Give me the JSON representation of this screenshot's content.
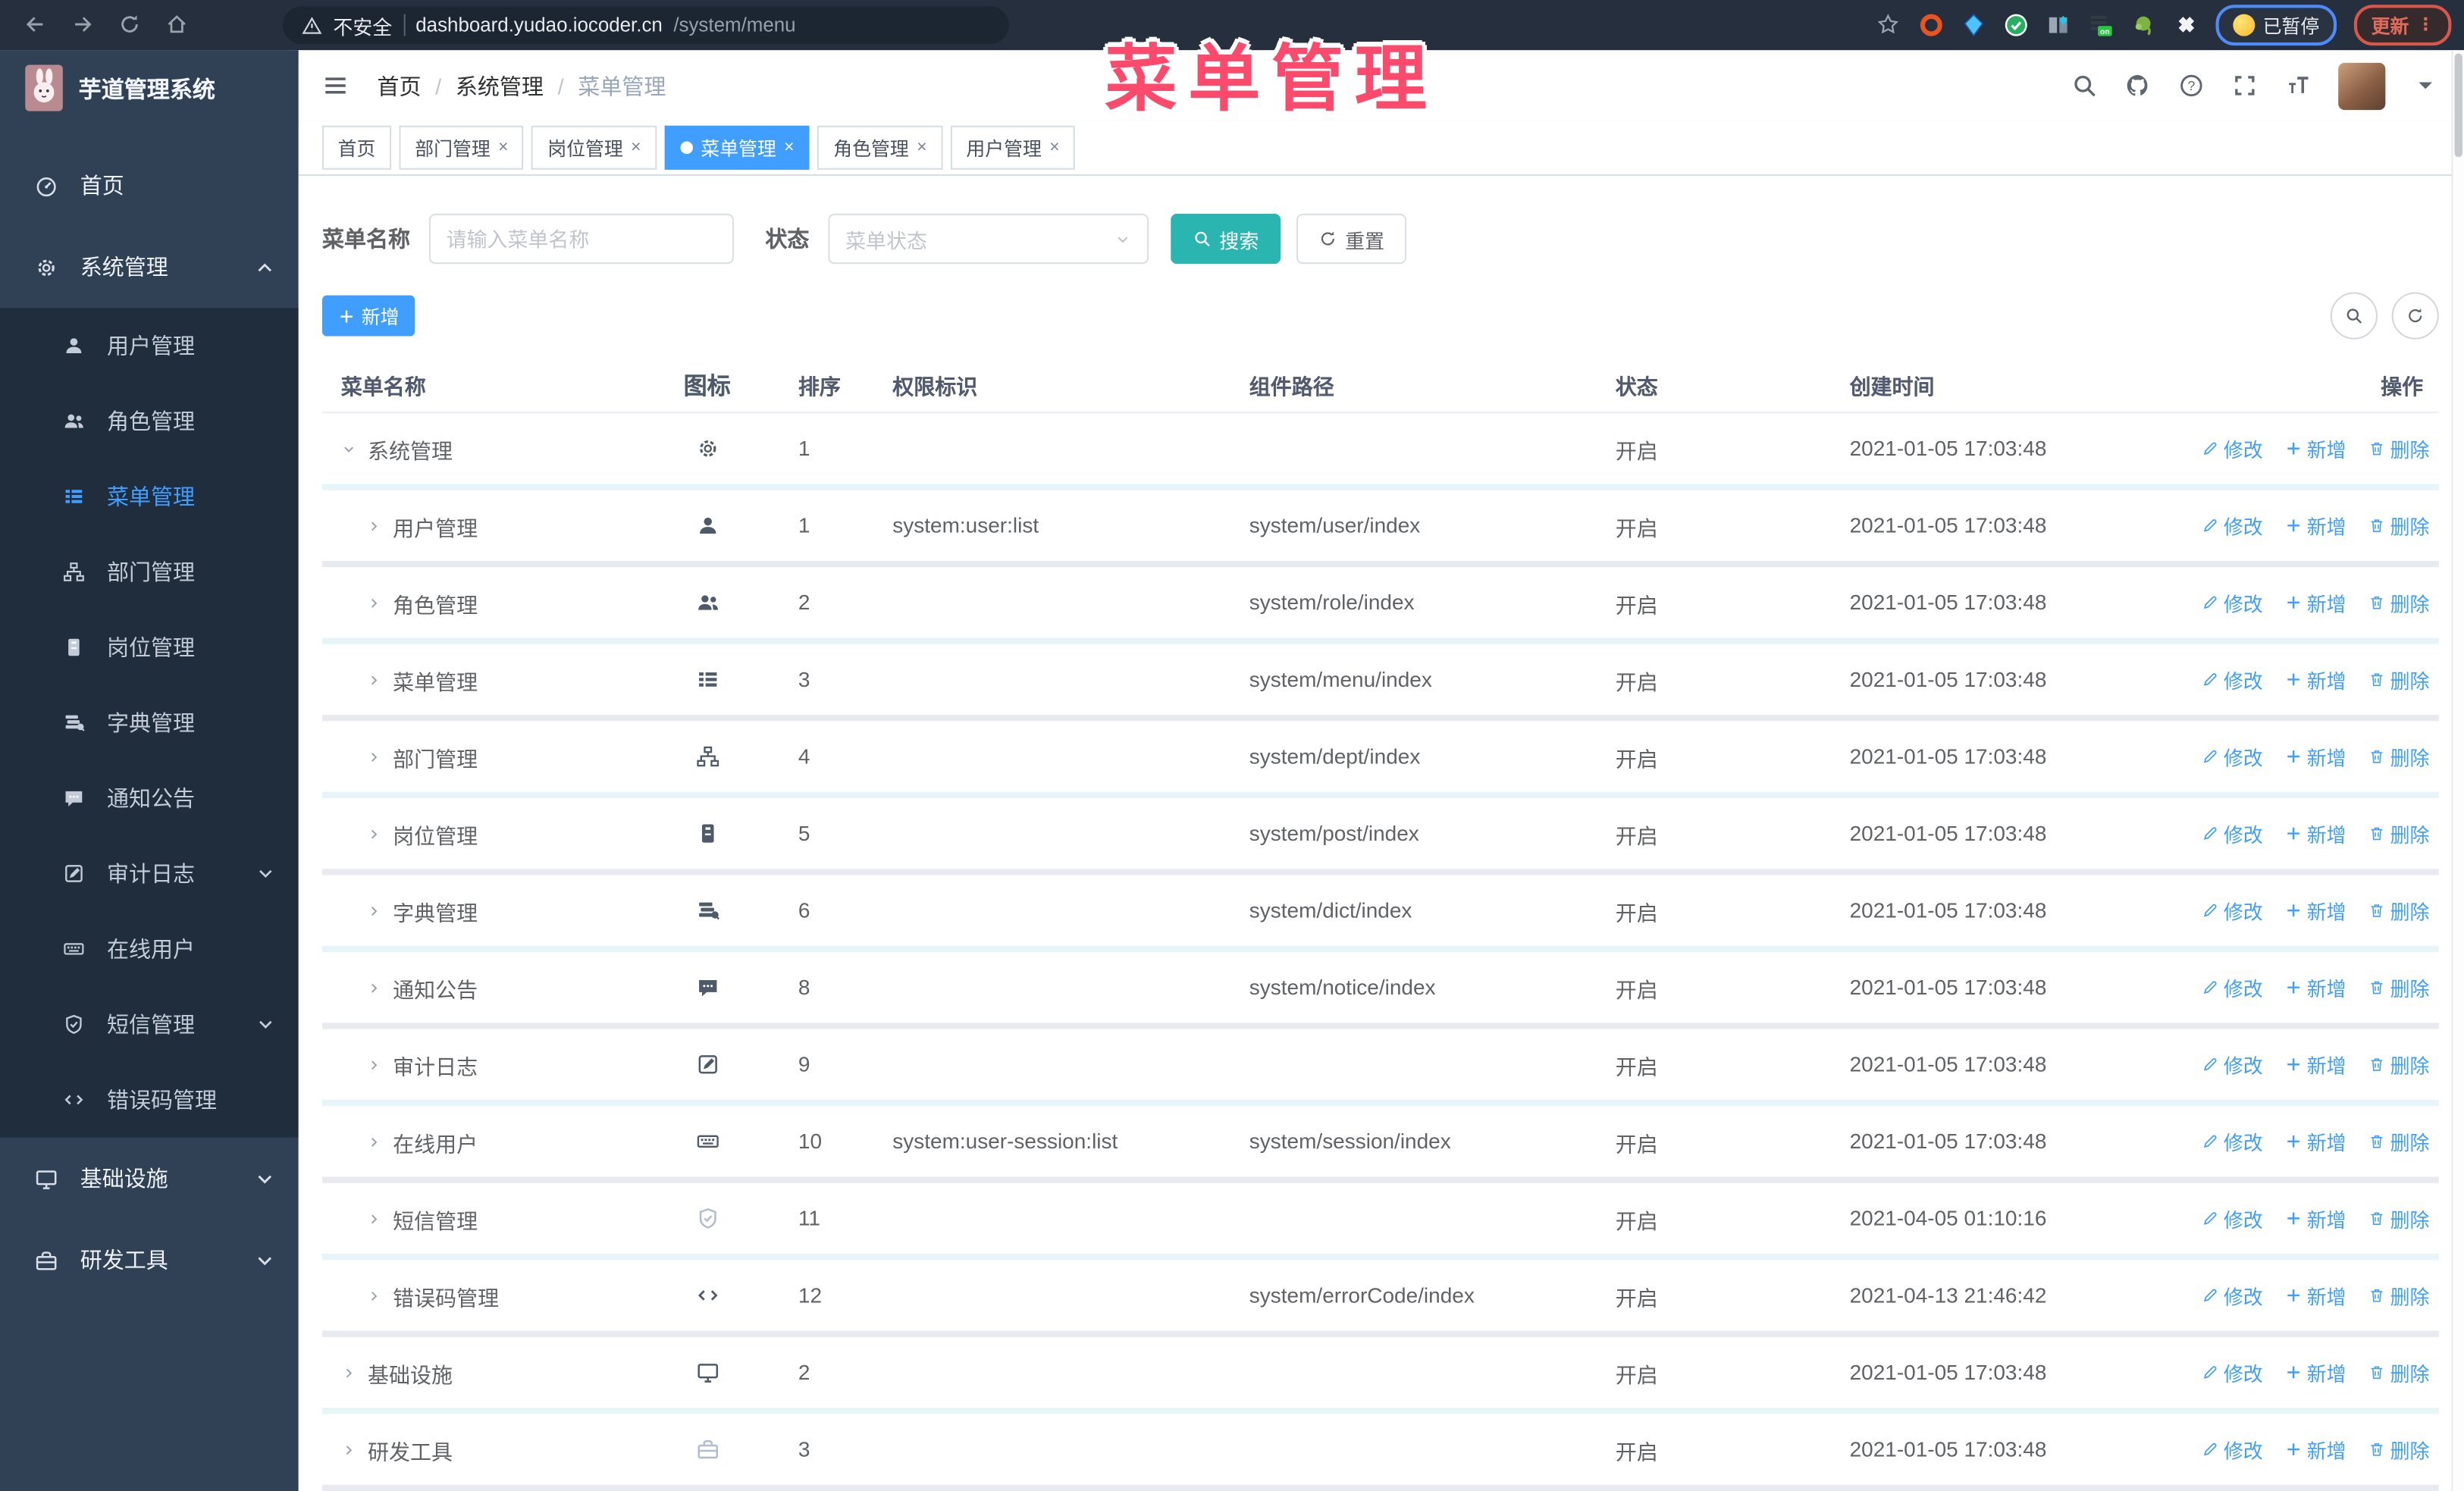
{
  "colors": {
    "accent": "#409eff",
    "search_teal": "#2bb5b0",
    "watermark_pink": "#fb4a6b",
    "sidebar_bg": "#304156",
    "submenu_bg": "#1f2d3d"
  },
  "browser": {
    "security_label": "不安全",
    "url_host": "dashboard.yudao.iocoder.cn",
    "url_path": "/system/menu",
    "extensions": [
      "orange-ring-extension",
      "blue-gem-extension",
      "green-check-extension",
      "blue-tiles-extension",
      "list-on-extension",
      "green-monkey-extension",
      "puzzle-extension"
    ],
    "paused_label": "已暂停",
    "update_label": "更新"
  },
  "watermark": "菜单管理",
  "app": {
    "title": "芋道管理系统"
  },
  "breadcrumb": [
    "首页",
    "系统管理",
    "菜单管理"
  ],
  "sidebar": {
    "items": [
      {
        "key": "home",
        "label": "首页",
        "icon": "gauge",
        "level": 0
      },
      {
        "key": "system-management",
        "label": "系统管理",
        "icon": "gear",
        "level": 0,
        "chevron": "up"
      },
      {
        "key": "user-management",
        "label": "用户管理",
        "icon": "user",
        "level": 1
      },
      {
        "key": "role-management",
        "label": "角色管理",
        "icon": "users",
        "level": 1
      },
      {
        "key": "menu-management",
        "label": "菜单管理",
        "icon": "menu",
        "level": 1,
        "active": true
      },
      {
        "key": "dept-management",
        "label": "部门管理",
        "icon": "tree",
        "level": 1
      },
      {
        "key": "post-management",
        "label": "岗位管理",
        "icon": "badge",
        "level": 1
      },
      {
        "key": "dict-management",
        "label": "字典管理",
        "icon": "book",
        "level": 1
      },
      {
        "key": "notice",
        "label": "通知公告",
        "icon": "chat",
        "level": 1
      },
      {
        "key": "audit-log",
        "label": "审计日志",
        "icon": "note",
        "level": 1,
        "chevron": "down"
      },
      {
        "key": "online-users",
        "label": "在线用户",
        "icon": "keyboard",
        "level": 1
      },
      {
        "key": "sms-management",
        "label": "短信管理",
        "icon": "shield",
        "level": 1,
        "chevron": "down"
      },
      {
        "key": "error-code-management",
        "label": "错误码管理",
        "icon": "code",
        "level": 1
      },
      {
        "key": "infrastructure",
        "label": "基础设施",
        "icon": "monitor",
        "level": 0,
        "chevron": "down"
      },
      {
        "key": "dev-tools",
        "label": "研发工具",
        "icon": "toolbox",
        "level": 0,
        "chevron": "down"
      }
    ]
  },
  "tabs": [
    {
      "key": "home",
      "label": "首页",
      "closable": false,
      "active": false
    },
    {
      "key": "dept",
      "label": "部门管理",
      "closable": true,
      "active": false
    },
    {
      "key": "post",
      "label": "岗位管理",
      "closable": true,
      "active": false
    },
    {
      "key": "menu",
      "label": "菜单管理",
      "closable": true,
      "active": true
    },
    {
      "key": "role",
      "label": "角色管理",
      "closable": true,
      "active": false
    },
    {
      "key": "user",
      "label": "用户管理",
      "closable": true,
      "active": false
    }
  ],
  "filters": {
    "name_label": "菜单名称",
    "name_placeholder": "请输入菜单名称",
    "status_label": "状态",
    "status_placeholder": "菜单状态",
    "search_label": "搜索",
    "reset_label": "重置"
  },
  "toolbar": {
    "add_label": "新增"
  },
  "table": {
    "columns": [
      "菜单名称",
      "图标",
      "排序",
      "权限标识",
      "组件路径",
      "状态",
      "创建时间",
      "操作"
    ],
    "action_labels": {
      "edit": "修改",
      "add": "新增",
      "del": "删除"
    },
    "rows": [
      {
        "name": "系统管理",
        "level": 0,
        "caret": "down",
        "icon": "gear",
        "sort": "1",
        "perm": "",
        "path": "",
        "status": "开启",
        "time": "2021-01-05 17:03:48"
      },
      {
        "name": "用户管理",
        "level": 1,
        "caret": "right",
        "icon": "user",
        "sort": "1",
        "perm": "system:user:list",
        "path": "system/user/index",
        "status": "开启",
        "time": "2021-01-05 17:03:48"
      },
      {
        "name": "角色管理",
        "level": 1,
        "caret": "right",
        "icon": "users",
        "sort": "2",
        "perm": "",
        "path": "system/role/index",
        "status": "开启",
        "time": "2021-01-05 17:03:48"
      },
      {
        "name": "菜单管理",
        "level": 1,
        "caret": "right",
        "icon": "menu",
        "sort": "3",
        "perm": "",
        "path": "system/menu/index",
        "status": "开启",
        "time": "2021-01-05 17:03:48"
      },
      {
        "name": "部门管理",
        "level": 1,
        "caret": "right",
        "icon": "tree",
        "sort": "4",
        "perm": "",
        "path": "system/dept/index",
        "status": "开启",
        "time": "2021-01-05 17:03:48"
      },
      {
        "name": "岗位管理",
        "level": 1,
        "caret": "right",
        "icon": "badge",
        "sort": "5",
        "perm": "",
        "path": "system/post/index",
        "status": "开启",
        "time": "2021-01-05 17:03:48"
      },
      {
        "name": "字典管理",
        "level": 1,
        "caret": "right",
        "icon": "book",
        "sort": "6",
        "perm": "",
        "path": "system/dict/index",
        "status": "开启",
        "time": "2021-01-05 17:03:48"
      },
      {
        "name": "通知公告",
        "level": 1,
        "caret": "right",
        "icon": "chat",
        "sort": "8",
        "perm": "",
        "path": "system/notice/index",
        "status": "开启",
        "time": "2021-01-05 17:03:48"
      },
      {
        "name": "审计日志",
        "level": 1,
        "caret": "right",
        "icon": "note",
        "sort": "9",
        "perm": "",
        "path": "",
        "status": "开启",
        "time": "2021-01-05 17:03:48"
      },
      {
        "name": "在线用户",
        "level": 1,
        "caret": "right",
        "icon": "keyboard",
        "sort": "10",
        "perm": "system:user-session:list",
        "path": "system/session/index",
        "status": "开启",
        "time": "2021-01-05 17:03:48"
      },
      {
        "name": "短信管理",
        "level": 1,
        "caret": "right",
        "icon": "shield",
        "muted": true,
        "sort": "11",
        "perm": "",
        "path": "",
        "status": "开启",
        "time": "2021-04-05 01:10:16"
      },
      {
        "name": "错误码管理",
        "level": 1,
        "caret": "right",
        "icon": "code",
        "sort": "12",
        "perm": "",
        "path": "system/errorCode/index",
        "status": "开启",
        "time": "2021-04-13 21:46:42"
      },
      {
        "name": "基础设施",
        "level": 0,
        "caret": "right",
        "icon": "monitor",
        "sort": "2",
        "perm": "",
        "path": "",
        "status": "开启",
        "time": "2021-01-05 17:03:48"
      },
      {
        "name": "研发工具",
        "level": 0,
        "caret": "right",
        "icon": "toolbox",
        "muted": true,
        "sort": "3",
        "perm": "",
        "path": "",
        "status": "开启",
        "time": "2021-01-05 17:03:48"
      }
    ]
  }
}
